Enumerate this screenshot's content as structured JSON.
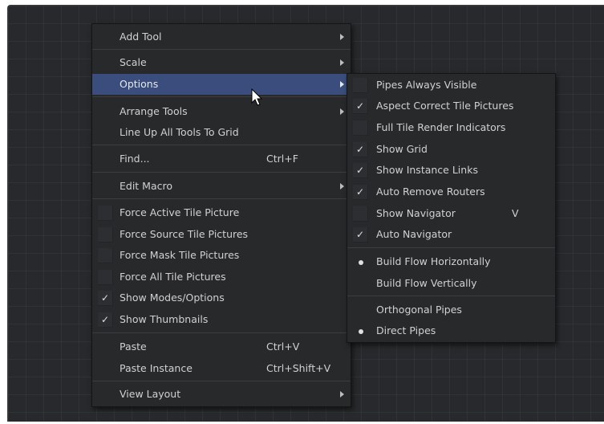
{
  "main_menu": {
    "add_tool": "Add Tool",
    "scale": "Scale",
    "options": "Options",
    "arrange_tools": "Arrange Tools",
    "line_up": "Line Up All Tools To Grid",
    "find": "Find...",
    "find_shortcut": "Ctrl+F",
    "edit_macro": "Edit Macro",
    "force_active": "Force Active Tile Picture",
    "force_source": "Force Source Tile Pictures",
    "force_mask": "Force Mask Tile Pictures",
    "force_all": "Force All Tile Pictures",
    "show_modes": "Show Modes/Options",
    "show_thumbnails": "Show Thumbnails",
    "paste": "Paste",
    "paste_shortcut": "Ctrl+V",
    "paste_instance": "Paste Instance",
    "paste_instance_shortcut": "Ctrl+Shift+V",
    "view_layout": "View Layout",
    "check_mark": "✓"
  },
  "options_menu": {
    "pipes_visible": "Pipes Always Visible",
    "aspect_correct": "Aspect Correct Tile Pictures",
    "full_tile": "Full Tile Render Indicators",
    "show_grid": "Show Grid",
    "show_instance_links": "Show Instance Links",
    "auto_remove_routers": "Auto Remove Routers",
    "show_navigator": "Show Navigator",
    "show_navigator_shortcut": "V",
    "auto_navigator": "Auto Navigator",
    "build_horizontally": "Build Flow Horizontally",
    "build_vertically": "Build Flow Vertically",
    "orthogonal_pipes": "Orthogonal Pipes",
    "direct_pipes": "Direct Pipes"
  },
  "states": {
    "force_active": false,
    "force_source": false,
    "force_mask": false,
    "force_all": false,
    "show_modes": true,
    "show_thumbnails": true,
    "pipes_visible": false,
    "aspect_correct": true,
    "full_tile": false,
    "show_grid": true,
    "show_instance_links": true,
    "auto_remove_routers": true,
    "show_navigator": false,
    "auto_navigator": true,
    "build_flow": "horizontal",
    "pipe_style": "direct"
  },
  "colors": {
    "canvas": "#27292c",
    "menu": "#28292b",
    "highlight": "#3b4d7c",
    "text": "#d1d1d1"
  },
  "icons": {
    "cursor": "arrow-pointer-icon",
    "submenu": "submenu-arrow-icon",
    "check": "checkmark-icon",
    "radio": "radio-dot-icon"
  }
}
